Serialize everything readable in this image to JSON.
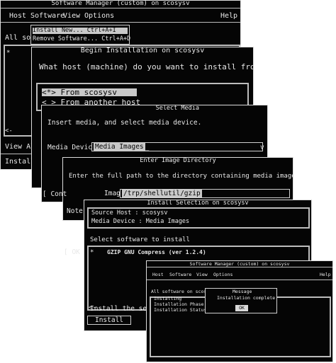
{
  "win1": {
    "title": "Software Manager (custom) on scosysv",
    "menus": [
      "Host",
      "Software",
      "View",
      "Options"
    ],
    "help": "Help",
    "software_menu": [
      "Install New...   Ctrl+A+I",
      "Remove Software...  Ctrl+A+D"
    ],
    "all_software": "All sof",
    "view_all": "View All",
    "install_new": "Install new"
  },
  "win2": {
    "title": "Begin Installation on scosysv",
    "question": "What host (machine) do you want to install from?",
    "option_1": "<*> From scosysv",
    "option_2": "< > From another host"
  },
  "win3": {
    "title": "Select Media",
    "instruction": "Insert media, and select media device.",
    "device_label": "Media Device:",
    "device_value": "Media Images",
    "dropdown_arrow": "v"
  },
  "win4": {
    "title": "Enter Image Directory",
    "instruction": "Enter the full path to the directory containing media images.",
    "dir_label": "Image Directory:",
    "dir_value": "/trp/shellutil/gzip",
    "cont_partial": "[ Cont",
    "note_partial": "Note:"
  },
  "win5": {
    "title": "Install Selection on scosysv",
    "source_host": "Source Host  : scosysv",
    "media_device": "Media Device : Media Images",
    "select_label": "Select software to install",
    "item": "GZIP GNU Compress (ver 1.2.4)",
    "ok_partial": "[ OK",
    "install_selected": "Install the selected",
    "install_button": "Install"
  },
  "win6": {
    "title": "Software Manager (custom) on scosysv",
    "menus": [
      "Host",
      "Software",
      "View",
      "Options"
    ],
    "help": "Help",
    "all_software": "All software on scosysv.local.com",
    "installing": "Installing",
    "install_phase": "Installation Phase",
    "install_status": "Installation Status",
    "message_title": "Message",
    "message_text": "Installation complete",
    "ok_button": "OK"
  }
}
